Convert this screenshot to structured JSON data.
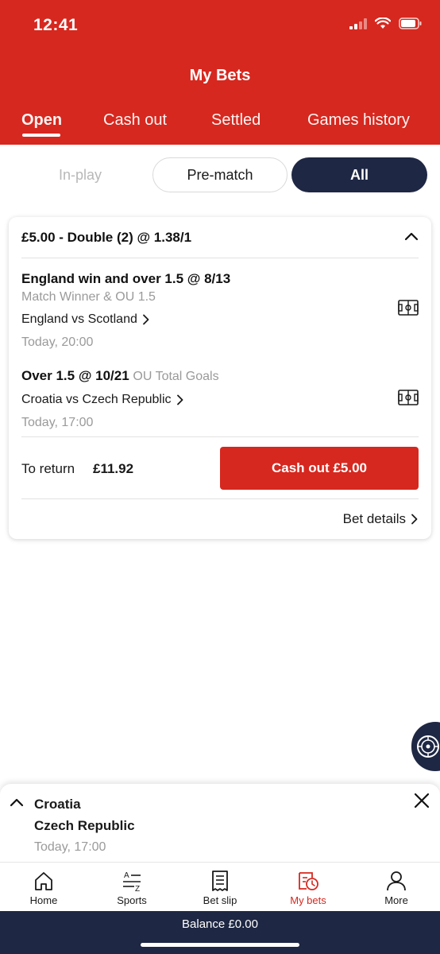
{
  "status_bar": {
    "time": "12:41"
  },
  "header": {
    "title": "My Bets"
  },
  "tabs": [
    {
      "label": "Open",
      "active": true
    },
    {
      "label": "Cash out",
      "active": false
    },
    {
      "label": "Settled",
      "active": false
    },
    {
      "label": "Games history",
      "active": false
    }
  ],
  "filters": {
    "inplay": "In-play",
    "prematch": "Pre-match",
    "all": "All",
    "selected": "All"
  },
  "bet": {
    "header": "£5.00 - Double (2) @ 1.38/1",
    "selections": [
      {
        "title": "England win and over 1.5 @ 8/13",
        "market": "Match Winner & OU 1.5",
        "match": "England vs Scotland",
        "time": "Today, 20:00",
        "icon": "pitch-icon"
      },
      {
        "title": "Over 1.5 @ 10/21",
        "market": "OU Total Goals",
        "match": "Croatia vs Czech Republic",
        "time": "Today, 17:00",
        "icon": "pitch-icon"
      }
    ],
    "to_return_label": "To return",
    "to_return_value": "£11.92",
    "cashout_label": "Cash out £5.00",
    "details_label": "Bet details"
  },
  "live_panel": {
    "team1": "Croatia",
    "team2": "Czech Republic",
    "time": "Today, 17:00"
  },
  "bottom_nav": [
    {
      "label": "Home",
      "icon": "home-icon",
      "active": false
    },
    {
      "label": "Sports",
      "icon": "sports-az-icon",
      "active": false
    },
    {
      "label": "Bet slip",
      "icon": "betslip-icon",
      "active": false
    },
    {
      "label": "My bets",
      "icon": "mybets-icon",
      "active": true
    },
    {
      "label": "More",
      "icon": "user-icon",
      "active": false
    }
  ],
  "balance": {
    "label": "Balance £0.00"
  },
  "colors": {
    "brand_red": "#d6281f",
    "navy": "#1e2743",
    "grey_text": "#9a9a9a"
  }
}
